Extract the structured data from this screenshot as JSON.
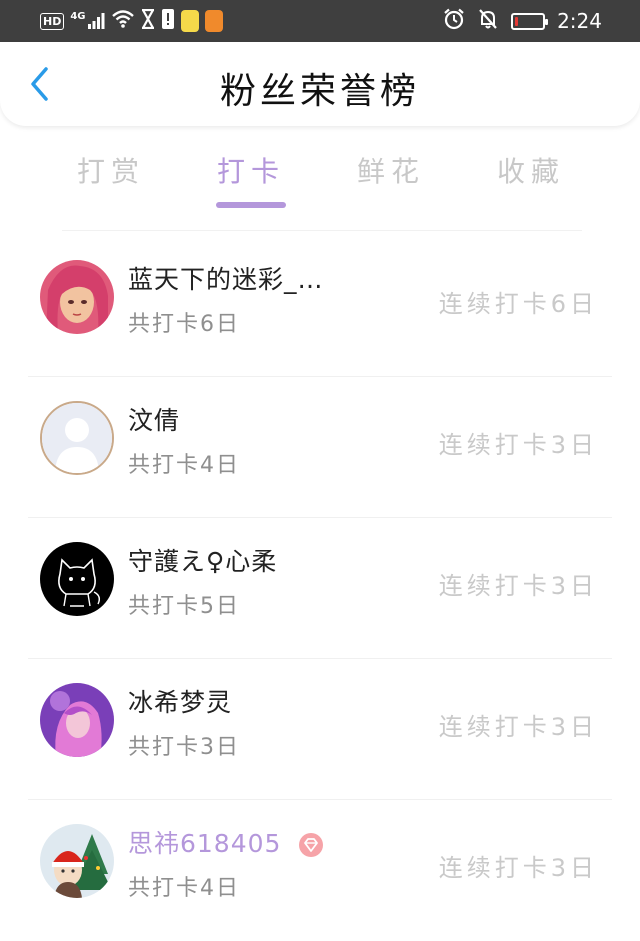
{
  "status_bar": {
    "hd": "HD",
    "network": "4G",
    "time": "2:24",
    "battery_level": 0.12
  },
  "header": {
    "title": "粉丝荣誉榜"
  },
  "tabs": [
    {
      "label": "打赏",
      "active": false
    },
    {
      "label": "打卡",
      "active": true
    },
    {
      "label": "鲜花",
      "active": false
    },
    {
      "label": "收藏",
      "active": false
    }
  ],
  "fans": [
    {
      "name": "蓝天下的迷彩_…",
      "total": "共打卡6日",
      "streak": "连续打卡6日",
      "vip": false
    },
    {
      "name": "汶倩",
      "total": "共打卡4日",
      "streak": "连续打卡3日",
      "vip": false
    },
    {
      "name": "守護え♀心柔",
      "total": "共打卡5日",
      "streak": "连续打卡3日",
      "vip": false
    },
    {
      "name": "冰希梦灵",
      "total": "共打卡3日",
      "streak": "连续打卡3日",
      "vip": false
    },
    {
      "name": "思祎618405",
      "total": "共打卡4日",
      "streak": "连续打卡3日",
      "vip": true
    }
  ],
  "colors": {
    "accent": "#b497db",
    "status_bar": "#3f3f3f",
    "back_arrow": "#2a9be8",
    "inactive_tab": "#c8c8c8"
  }
}
